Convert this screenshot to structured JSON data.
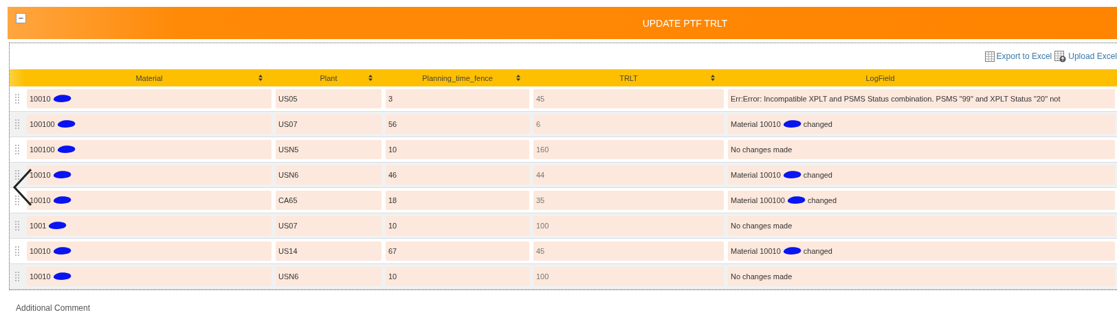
{
  "panel": {
    "title": "UPDATE PTF TRLT",
    "collapsed": false
  },
  "toolbar": {
    "links": [
      {
        "kind": "export",
        "label": "Export to Excel"
      },
      {
        "kind": "upload",
        "label": "Upload Excel"
      }
    ]
  },
  "table": {
    "columns": [
      {
        "label": "Material",
        "sortable": true
      },
      {
        "label": "Plant",
        "sortable": true
      },
      {
        "label": "Planning_time_fence",
        "sortable": true
      },
      {
        "label": "TRLT",
        "sortable": true
      },
      {
        "label": "LogField",
        "sortable": false
      }
    ],
    "rows": [
      {
        "material": "10010",
        "plant": "US05",
        "ptf": "3",
        "trlt": "45",
        "log": {
          "kind": "text",
          "text": "Err:Error: Incompatible XPLT and PSMS Status combination. PSMS \"99\" and XPLT Status \"20\"  not"
        }
      },
      {
        "material": "100100",
        "plant": "US07",
        "ptf": "56",
        "trlt": "6",
        "log": {
          "kind": "redacted",
          "before": "Material 10010",
          "after": "changed"
        }
      },
      {
        "material": "100100",
        "plant": "USN5",
        "ptf": "10",
        "trlt": "160",
        "log": {
          "kind": "text",
          "text": "No changes made"
        }
      },
      {
        "material": "10010",
        "plant": "USN6",
        "ptf": "46",
        "trlt": "44",
        "log": {
          "kind": "redacted",
          "before": "Material 10010",
          "after": "changed"
        }
      },
      {
        "material": "10010",
        "plant": "CA65",
        "ptf": "18",
        "trlt": "35",
        "log": {
          "kind": "redacted",
          "before": "Material 100100",
          "after": "changed"
        }
      },
      {
        "material": "1001",
        "plant": "US07",
        "ptf": "10",
        "trlt": "100",
        "log": {
          "kind": "text",
          "text": "No changes made"
        }
      },
      {
        "material": "10010",
        "plant": "US14",
        "ptf": "67",
        "trlt": "45",
        "log": {
          "kind": "redacted",
          "before": "Material 10010",
          "after": "changed"
        }
      },
      {
        "material": "10010",
        "plant": "USN6",
        "ptf": "10",
        "trlt": "100",
        "log": {
          "kind": "text",
          "text": "No changes made"
        }
      }
    ]
  },
  "comment": {
    "label": "Additional Comment"
  }
}
